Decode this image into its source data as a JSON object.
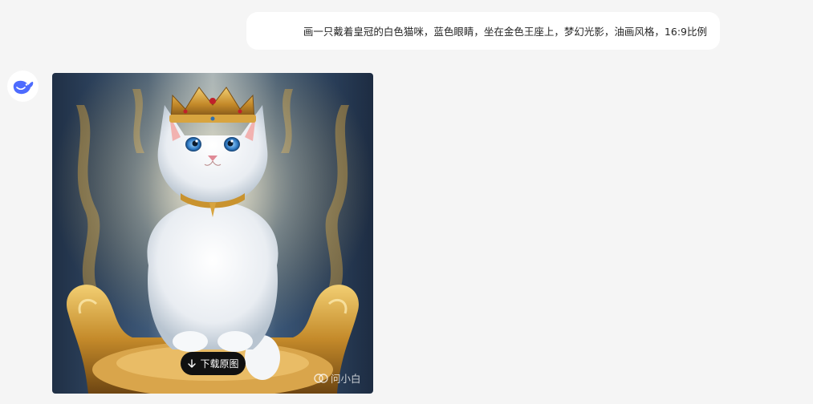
{
  "user_message": {
    "text": "画一只戴着皇冠的白色猫咪，蓝色眼睛，坐在金色王座上，梦幻光影，油画风格，16:9比例"
  },
  "assistant": {
    "avatar_icon": "whale-logo-icon",
    "image": {
      "subject": "white kitten with golden crown on golden throne, oil painting",
      "download_label": "下载原图",
      "download_icon": "arrow-down-icon",
      "watermark": "问小白"
    }
  },
  "colors": {
    "page_bg": "#f5f5f5",
    "bubble_bg": "#ffffff",
    "brand": "#4d6bfe",
    "button_bg": "#111111"
  }
}
